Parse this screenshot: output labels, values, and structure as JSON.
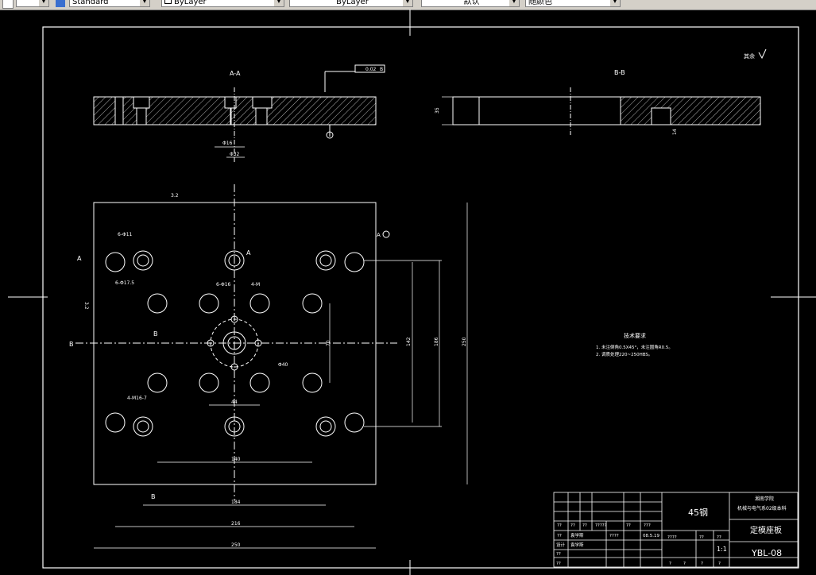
{
  "toolbar": {
    "text_style": "Standard",
    "layer": "ByLayer",
    "linetype": "ByLayer",
    "lineweight": "默认",
    "plot_style": "随颜色"
  },
  "drawing": {
    "section_aa": "A-A",
    "section_bb": "B-B",
    "roughness_note": "其余",
    "tolerance_box": "0.02",
    "datum_b": "B",
    "datum_a_tag": "A",
    "view_labels": {
      "a_left": "A",
      "a_right": "A",
      "b_left": "B",
      "b_mid": "B",
      "b_bottom": "B",
      "a_top": "A"
    },
    "dimensions": {
      "d140": "140",
      "d184": "184",
      "d216": "216",
      "d250_bottom": "250",
      "d250_right": "250",
      "d186": "186",
      "d142": "142",
      "d70": "70",
      "d44": "44",
      "d32": "Φ32",
      "d16": "Φ16",
      "d40": "Φ40",
      "d3": "3.2",
      "d35": "35",
      "d14": "14",
      "six_d11": "6-Φ11",
      "six_d175": "6-Φ17.5",
      "four_m16": "4-M16-7",
      "six_d16": "6-Φ16",
      "four_m": "4-M"
    },
    "tech_title": "技术要求",
    "tech_notes": [
      "1. 未注倒角0.5X45°，未注圆角R0.5。",
      "2. 调质处理220~250HBS。"
    ]
  },
  "title_block": {
    "school_line1": "湘南学院",
    "school_line2": "机械与电气系02级本科",
    "material": "45钢",
    "part_name": "定模座板",
    "drawing_no": "YBL-08",
    "scale": "1:1",
    "designer": "袁学斯",
    "date": "08.5.19",
    "checker": "袁学斯",
    "labels": [
      "??",
      "??",
      "??",
      "?????",
      "??",
      "???"
    ],
    "row_labels": [
      "??",
      "设计",
      "审核",
      "??",
      "??"
    ],
    "misc": [
      "????",
      "??",
      "??",
      "?",
      "?",
      "?",
      "?",
      "??",
      "??"
    ]
  }
}
